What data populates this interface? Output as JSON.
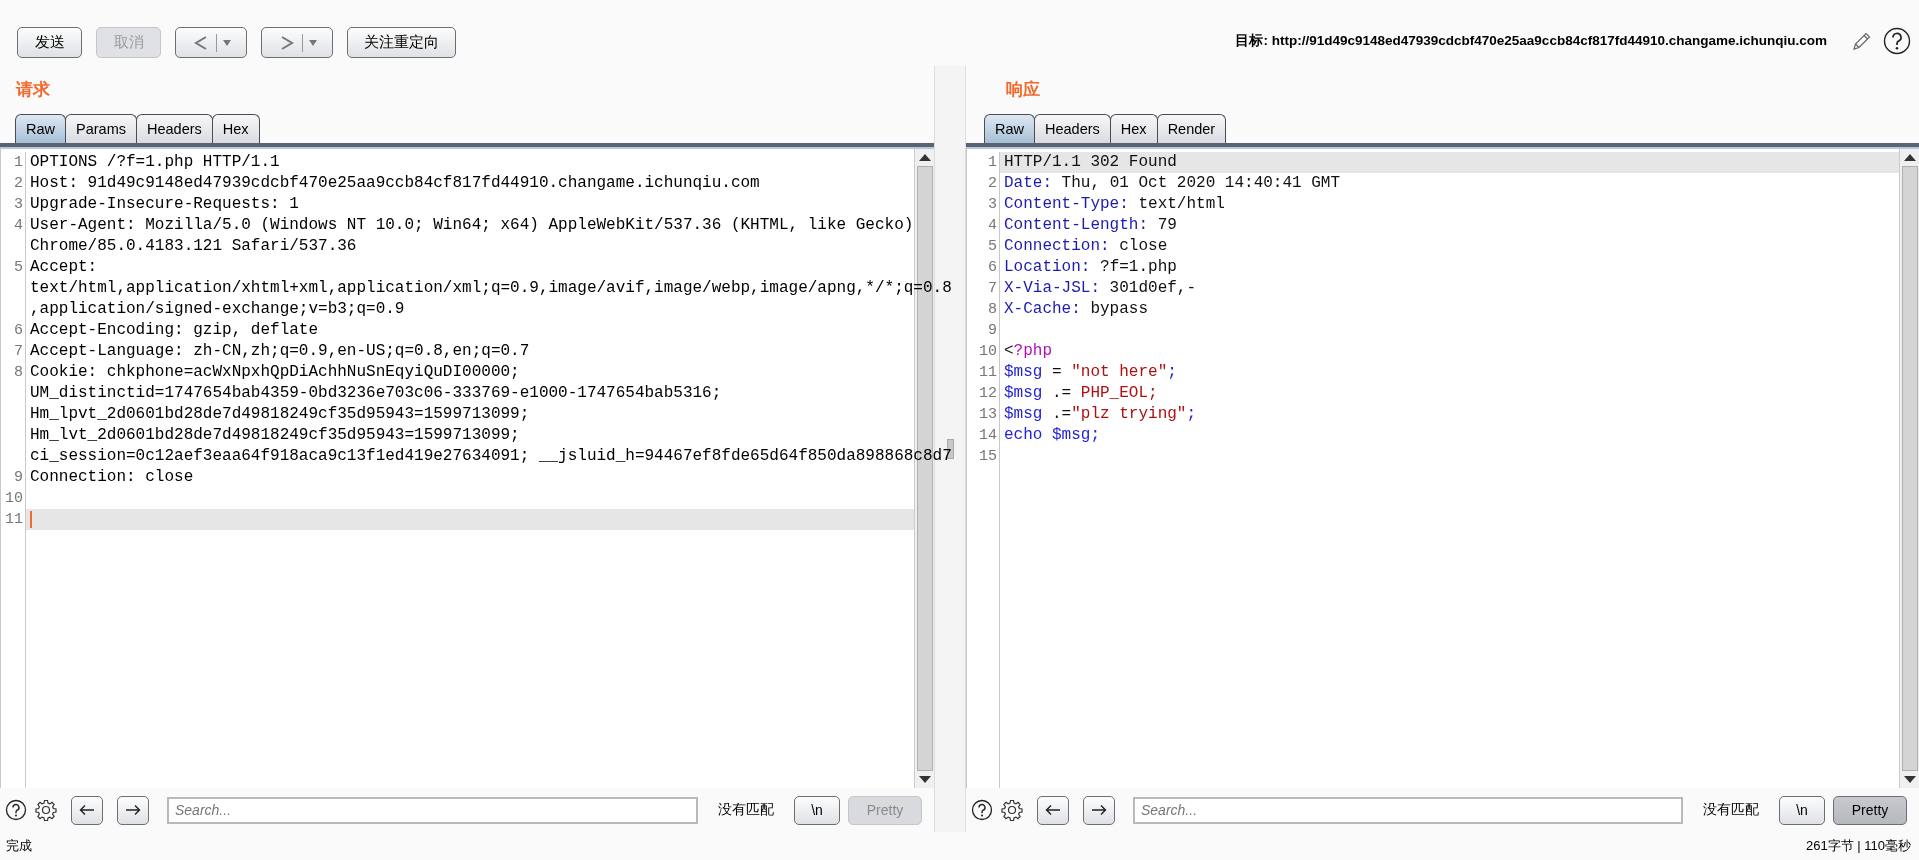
{
  "toolbar": {
    "buttons": [
      {
        "kind": "text",
        "label": "发送",
        "disabled": false
      },
      {
        "kind": "text",
        "label": "取消",
        "disabled": true
      },
      {
        "kind": "back",
        "disabled": false
      },
      {
        "kind": "forward",
        "disabled": false
      },
      {
        "kind": "text",
        "label": "关注重定向",
        "disabled": false
      }
    ],
    "target": "目标: http://91d49c9148ed47939cdcbf470e25aa9ccb84cf817fd44910.changame.ichunqiu.com"
  },
  "request": {
    "title": "请求",
    "caret_visible": true,
    "tabs": [
      {
        "label": "Raw",
        "selected": true
      },
      {
        "label": "Params",
        "selected": false
      },
      {
        "label": "Headers",
        "selected": false
      },
      {
        "label": "Hex",
        "selected": false
      }
    ],
    "lines": [
      {
        "number": "1",
        "current": false,
        "rows": [
          "OPTIONS /?f=1.php HTTP/1.1"
        ]
      },
      {
        "number": "2",
        "current": false,
        "rows": [
          "Host: 91d49c9148ed47939cdcbf470e25aa9ccb84cf817fd44910.changame.ichunqiu.com"
        ]
      },
      {
        "number": "3",
        "current": false,
        "rows": [
          "Upgrade-Insecure-Requests: 1"
        ]
      },
      {
        "number": "4",
        "current": false,
        "rows": [
          "User-Agent: Mozilla/5.0 (Windows NT 10.0; Win64; x64) AppleWebKit/537.36 (KHTML, like Gecko)",
          "Chrome/85.0.4183.121 Safari/537.36"
        ]
      },
      {
        "number": "5",
        "current": false,
        "rows": [
          "Accept:",
          "text/html,application/xhtml+xml,application/xml;q=0.9,image/avif,image/webp,image/apng,*/*;q=0.8",
          ",application/signed-exchange;v=b3;q=0.9"
        ]
      },
      {
        "number": "6",
        "current": false,
        "rows": [
          "Accept-Encoding: gzip, deflate"
        ]
      },
      {
        "number": "7",
        "current": false,
        "rows": [
          "Accept-Language: zh-CN,zh;q=0.9,en-US;q=0.8,en;q=0.7"
        ]
      },
      {
        "number": "8",
        "current": false,
        "rows": [
          "Cookie: chkphone=acWxNpxhQpDiAchhNuSnEqyiQuDI00000;",
          "UM_distinctid=1747654bab4359-0bd3236e703c06-333769-e1000-1747654bab5316;",
          "Hm_lpvt_2d0601bd28de7d49818249cf35d95943=1599713099;",
          "Hm_lvt_2d0601bd28de7d49818249cf35d95943=1599713099;",
          "ci_session=0c12aef3eaa64f918aca9c13f1ed419e27634091; __jsluid_h=94467ef8fde65d64f850da898868c8d7"
        ]
      },
      {
        "number": "9",
        "current": false,
        "rows": [
          "Connection: close"
        ]
      },
      {
        "number": "10",
        "current": false
      },
      {
        "number": "11",
        "current": true
      }
    ],
    "search": {
      "placeholder": "Search...",
      "match": "没有匹配",
      "buttons": [
        {
          "label": "\\n",
          "disabled": false,
          "pressed": false
        },
        {
          "label": "Pretty",
          "disabled": true,
          "pressed": false
        }
      ]
    }
  },
  "response": {
    "title": "响应",
    "tabs": [
      {
        "label": "Raw",
        "selected": true
      },
      {
        "label": "Headers",
        "selected": false
      },
      {
        "label": "Hex",
        "selected": false
      },
      {
        "label": "Render",
        "selected": false
      }
    ],
    "lines": [
      {
        "number": "1",
        "current": true,
        "tokens": [
          {
            "kind": "plain",
            "text": "HTTP/1.1 302 Found"
          }
        ]
      },
      {
        "number": "2",
        "current": false,
        "tokens": [
          {
            "kind": "name",
            "text": "Date:"
          },
          {
            "kind": "plain",
            "text": " Thu, 01 Oct 2020 14:40:41 GMT"
          }
        ]
      },
      {
        "number": "3",
        "current": false,
        "tokens": [
          {
            "kind": "name",
            "text": "Content-Type:"
          },
          {
            "kind": "plain",
            "text": " text/html"
          }
        ]
      },
      {
        "number": "4",
        "current": false,
        "tokens": [
          {
            "kind": "name",
            "text": "Content-Length:"
          },
          {
            "kind": "plain",
            "text": " 79"
          }
        ]
      },
      {
        "number": "5",
        "current": false,
        "tokens": [
          {
            "kind": "name",
            "text": "Connection:"
          },
          {
            "kind": "plain",
            "text": " close"
          }
        ]
      },
      {
        "number": "6",
        "current": false,
        "tokens": [
          {
            "kind": "name",
            "text": "Location:"
          },
          {
            "kind": "plain",
            "text": " ?f=1.php"
          }
        ]
      },
      {
        "number": "7",
        "current": false,
        "tokens": [
          {
            "kind": "name",
            "text": "X-Via-JSL:"
          },
          {
            "kind": "plain",
            "text": " 301d0ef,-"
          }
        ]
      },
      {
        "number": "8",
        "current": false,
        "tokens": [
          {
            "kind": "name",
            "text": "X-Cache:"
          },
          {
            "kind": "plain",
            "text": " bypass"
          }
        ]
      },
      {
        "number": "9",
        "current": false
      },
      {
        "number": "10",
        "current": false,
        "tokens": [
          {
            "kind": "plain",
            "text": "<"
          },
          {
            "kind": "tag",
            "text": "?php"
          }
        ]
      },
      {
        "number": "11",
        "current": false,
        "tokens": [
          {
            "kind": "var",
            "text": "$msg"
          },
          {
            "kind": "plain",
            "text": " = "
          },
          {
            "kind": "string",
            "text": "\"not here\""
          },
          {
            "kind": "var",
            "text": ";"
          }
        ]
      },
      {
        "number": "12",
        "current": false,
        "tokens": [
          {
            "kind": "var",
            "text": "$msg"
          },
          {
            "kind": "plain",
            "text": " .= "
          },
          {
            "kind": "string",
            "text": "PHP_EOL;"
          }
        ]
      },
      {
        "number": "13",
        "current": false,
        "tokens": [
          {
            "kind": "var",
            "text": "$msg"
          },
          {
            "kind": "plain",
            "text": " .="
          },
          {
            "kind": "string",
            "text": "\"plz trying\""
          },
          {
            "kind": "var",
            "text": ";"
          }
        ]
      },
      {
        "number": "14",
        "current": false,
        "tokens": [
          {
            "kind": "var",
            "text": "echo $msg;"
          }
        ]
      },
      {
        "number": "15",
        "current": false
      }
    ],
    "search": {
      "placeholder": "Search...",
      "match": "没有匹配",
      "buttons": [
        {
          "label": "\\n",
          "disabled": false,
          "pressed": false
        },
        {
          "label": "Pretty",
          "disabled": false,
          "pressed": true
        }
      ]
    }
  },
  "status_bar": {
    "left": "完成",
    "right": "261字节 | 110毫秒"
  }
}
